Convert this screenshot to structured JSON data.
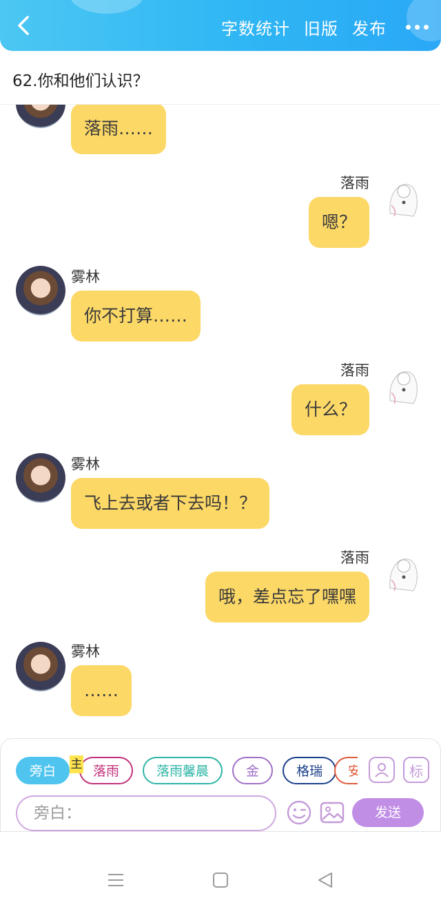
{
  "header": {
    "back_icon": "chevron-left-icon",
    "actions": [
      "字数统计",
      "旧版",
      "发布"
    ],
    "more_icon": "more-dots-icon"
  },
  "chapter": {
    "title": "62.你和他们认识？"
  },
  "messages": [
    {
      "side": "left",
      "speaker": "",
      "text": "落雨……"
    },
    {
      "side": "right",
      "speaker": "落雨",
      "text": "嗯？"
    },
    {
      "side": "left",
      "speaker": "雾林",
      "text": "你不打算……"
    },
    {
      "side": "right",
      "speaker": "落雨",
      "text": "什么？"
    },
    {
      "side": "left",
      "speaker": "雾林",
      "text": "飞上去或者下去吗！？"
    },
    {
      "side": "right",
      "speaker": "落雨",
      "text": "哦，差点忘了嘿嘿"
    },
    {
      "side": "left",
      "speaker": "雾林",
      "text": "……"
    }
  ],
  "composer": {
    "chips": [
      {
        "label": "旁白",
        "active": true
      },
      {
        "label": "落雨",
        "color": "#c2307a"
      },
      {
        "label": "落雨馨晨",
        "color": "#2bb5a5"
      },
      {
        "label": "金",
        "color": "#a070c8"
      },
      {
        "label": "格瑞",
        "color": "#1a3f8a"
      },
      {
        "label": "安",
        "color": "#e05a3a"
      }
    ],
    "main_tag": "主",
    "role_icon_button": "person-card-icon",
    "mark_button_label": "标",
    "input_placeholder": "旁白：",
    "emoji_icon": "emoji-wink-icon",
    "image_icon": "image-icon",
    "send_label": "发送"
  },
  "navbar": {
    "icons": [
      "menu-icon",
      "home-square-icon",
      "back-triangle-icon"
    ]
  },
  "colors": {
    "bubble": "#fcd867",
    "header": "#2fb6f4",
    "accent": "#c18ee6",
    "chip_active": "#4ec4ef"
  }
}
